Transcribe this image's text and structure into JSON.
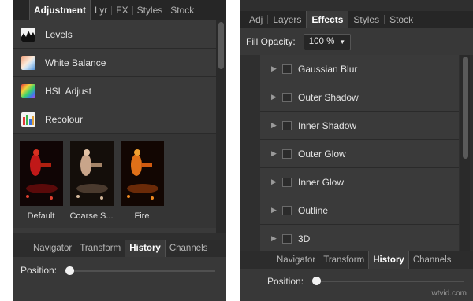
{
  "left": {
    "tabs": [
      "Adjustment",
      "Lyr",
      "FX",
      "Styles",
      "Stock"
    ],
    "adjustments": [
      {
        "label": "Levels",
        "icon": "levels-icon"
      },
      {
        "label": "White Balance",
        "icon": "white-balance-icon"
      },
      {
        "label": "HSL Adjust",
        "icon": "hsl-adjust-icon"
      },
      {
        "label": "Recolour",
        "icon": "recolour-icon"
      }
    ],
    "presets": [
      "Default",
      "Coarse S...",
      "Fire"
    ],
    "bottom_tabs": [
      "Navigator",
      "Transform",
      "History",
      "Channels"
    ],
    "position_label": "Position:"
  },
  "right": {
    "tabs": [
      "Adj",
      "Layers",
      "Effects",
      "Styles",
      "Stock"
    ],
    "fill_opacity_label": "Fill Opacity:",
    "fill_opacity_value": "100 %",
    "effects": [
      "Gaussian Blur",
      "Outer Shadow",
      "Inner Shadow",
      "Outer Glow",
      "Inner Glow",
      "Outline",
      "3D"
    ],
    "bottom_tabs": [
      "Navigator",
      "Transform",
      "History",
      "Channels"
    ],
    "position_label": "Position:"
  },
  "watermark": "wtvid.com",
  "colors": {
    "panel": "#2f2f2f",
    "active_tab_text": "#ffffff",
    "text": "#e4e4e4"
  }
}
